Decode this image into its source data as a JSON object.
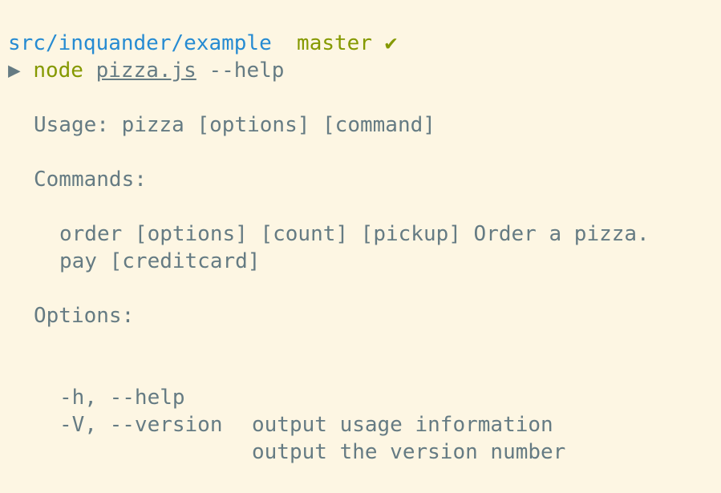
{
  "prompt": {
    "cwd": "src/inquander/example",
    "branch": "master",
    "status_glyph": "✔",
    "arrow": "▶",
    "command": "node",
    "file_arg": "pizza.js",
    "flag": "--help"
  },
  "output": {
    "usage": "Usage: pizza [options] [command]",
    "commands_heading": "Commands:",
    "commands": [
      {
        "text": "order [options] [count] [pickup] Order a pizza."
      },
      {
        "text": "pay [creditcard]"
      }
    ],
    "options_heading": "Options:",
    "options": [
      {
        "flag": "-h, --help",
        "description": "output usage information"
      },
      {
        "flag": "-V, --version",
        "description": "output the version number"
      }
    ]
  },
  "colors": {
    "background": "#fdf6e3",
    "text": "#657b83",
    "path": "#268bd2",
    "branch": "#859900"
  }
}
